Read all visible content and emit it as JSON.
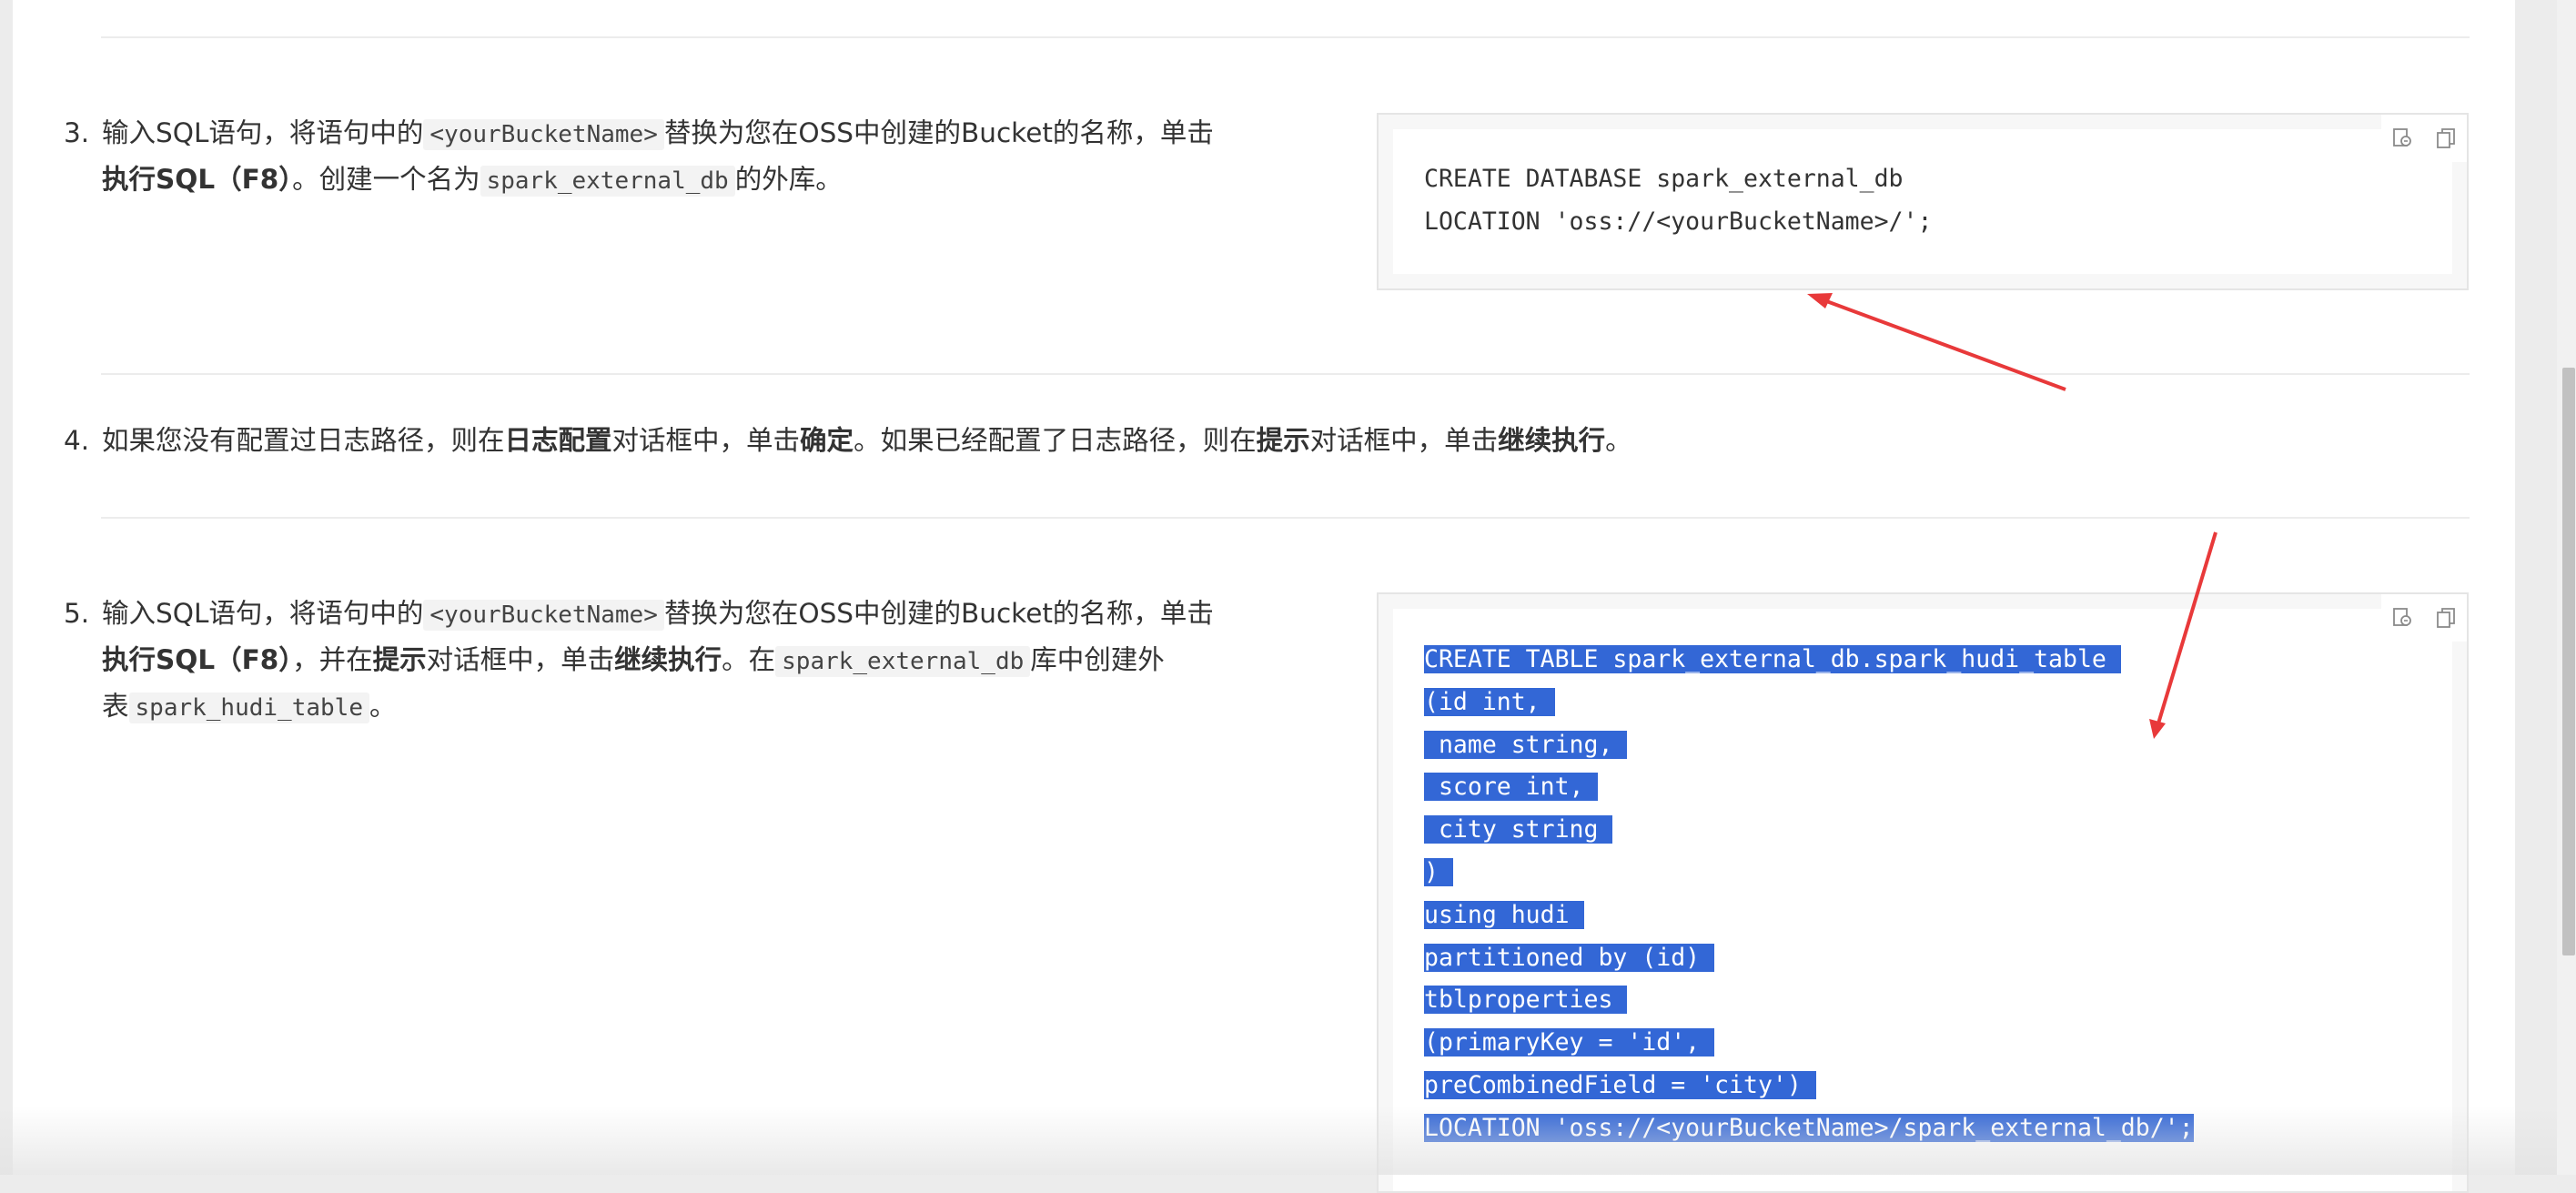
{
  "steps": [
    {
      "number": "3.",
      "line1": {
        "t1": "输入SQL语句，将语句中的",
        "code1": "<yourBucketName>",
        "t2": "替换为您在OSS中创建的Bucket的名称，单击"
      },
      "line2": {
        "bold": "执行SQL（F8）",
        "t1": "。创建一个名为",
        "code1": "spark_external_db",
        "t2": "的外库。"
      }
    },
    {
      "number": "4.",
      "t1": "如果您没有配置过日志路径，则在",
      "b1": "日志配置",
      "t2": "对话框中，单击",
      "b2": "确定",
      "t3": "。如果已经配置了日志路径，则在",
      "b3": "提示",
      "t4": "对话框中，单击",
      "b4": "继续执行",
      "t5": "。"
    },
    {
      "number": "5.",
      "line1": {
        "t1": "输入SQL语句，将语句中的",
        "code1": "<yourBucketName>",
        "t2": "替换为您在OSS中创建的Bucket的名称，单击"
      },
      "line2": {
        "b1": "执行SQL（F8）",
        "t1": "，并在",
        "b2": "提示",
        "t2": "对话框中，单击",
        "b3": "继续执行",
        "t3": "。在",
        "code1": "spark_external_db",
        "t4": "库中创建外"
      },
      "line3": {
        "t1": "表",
        "code1": "spark_hudi_table",
        "t2": "。"
      }
    }
  ],
  "code_blocks": [
    {
      "lines": [
        "CREATE DATABASE spark_external_db",
        "LOCATION 'oss://<yourBucketName>/';"
      ],
      "selected": false,
      "icons": [
        "copy-to-editor-icon",
        "copy-icon"
      ]
    },
    {
      "lines": [
        "CREATE TABLE spark_external_db.spark_hudi_table ",
        "(id int, ",
        " name string, ",
        " score int, ",
        " city string ",
        ") ",
        "using hudi ",
        "partitioned by (id) ",
        "tblproperties ",
        "(primaryKey = 'id', ",
        "preCombinedField = 'city') ",
        "LOCATION 'oss://<yourBucketName>/spark_external_db/';"
      ],
      "selected": true,
      "icons": [
        "copy-to-editor-icon",
        "copy-icon"
      ]
    }
  ],
  "annotation_color": "#e8393a",
  "selection_color": "#3367d6"
}
